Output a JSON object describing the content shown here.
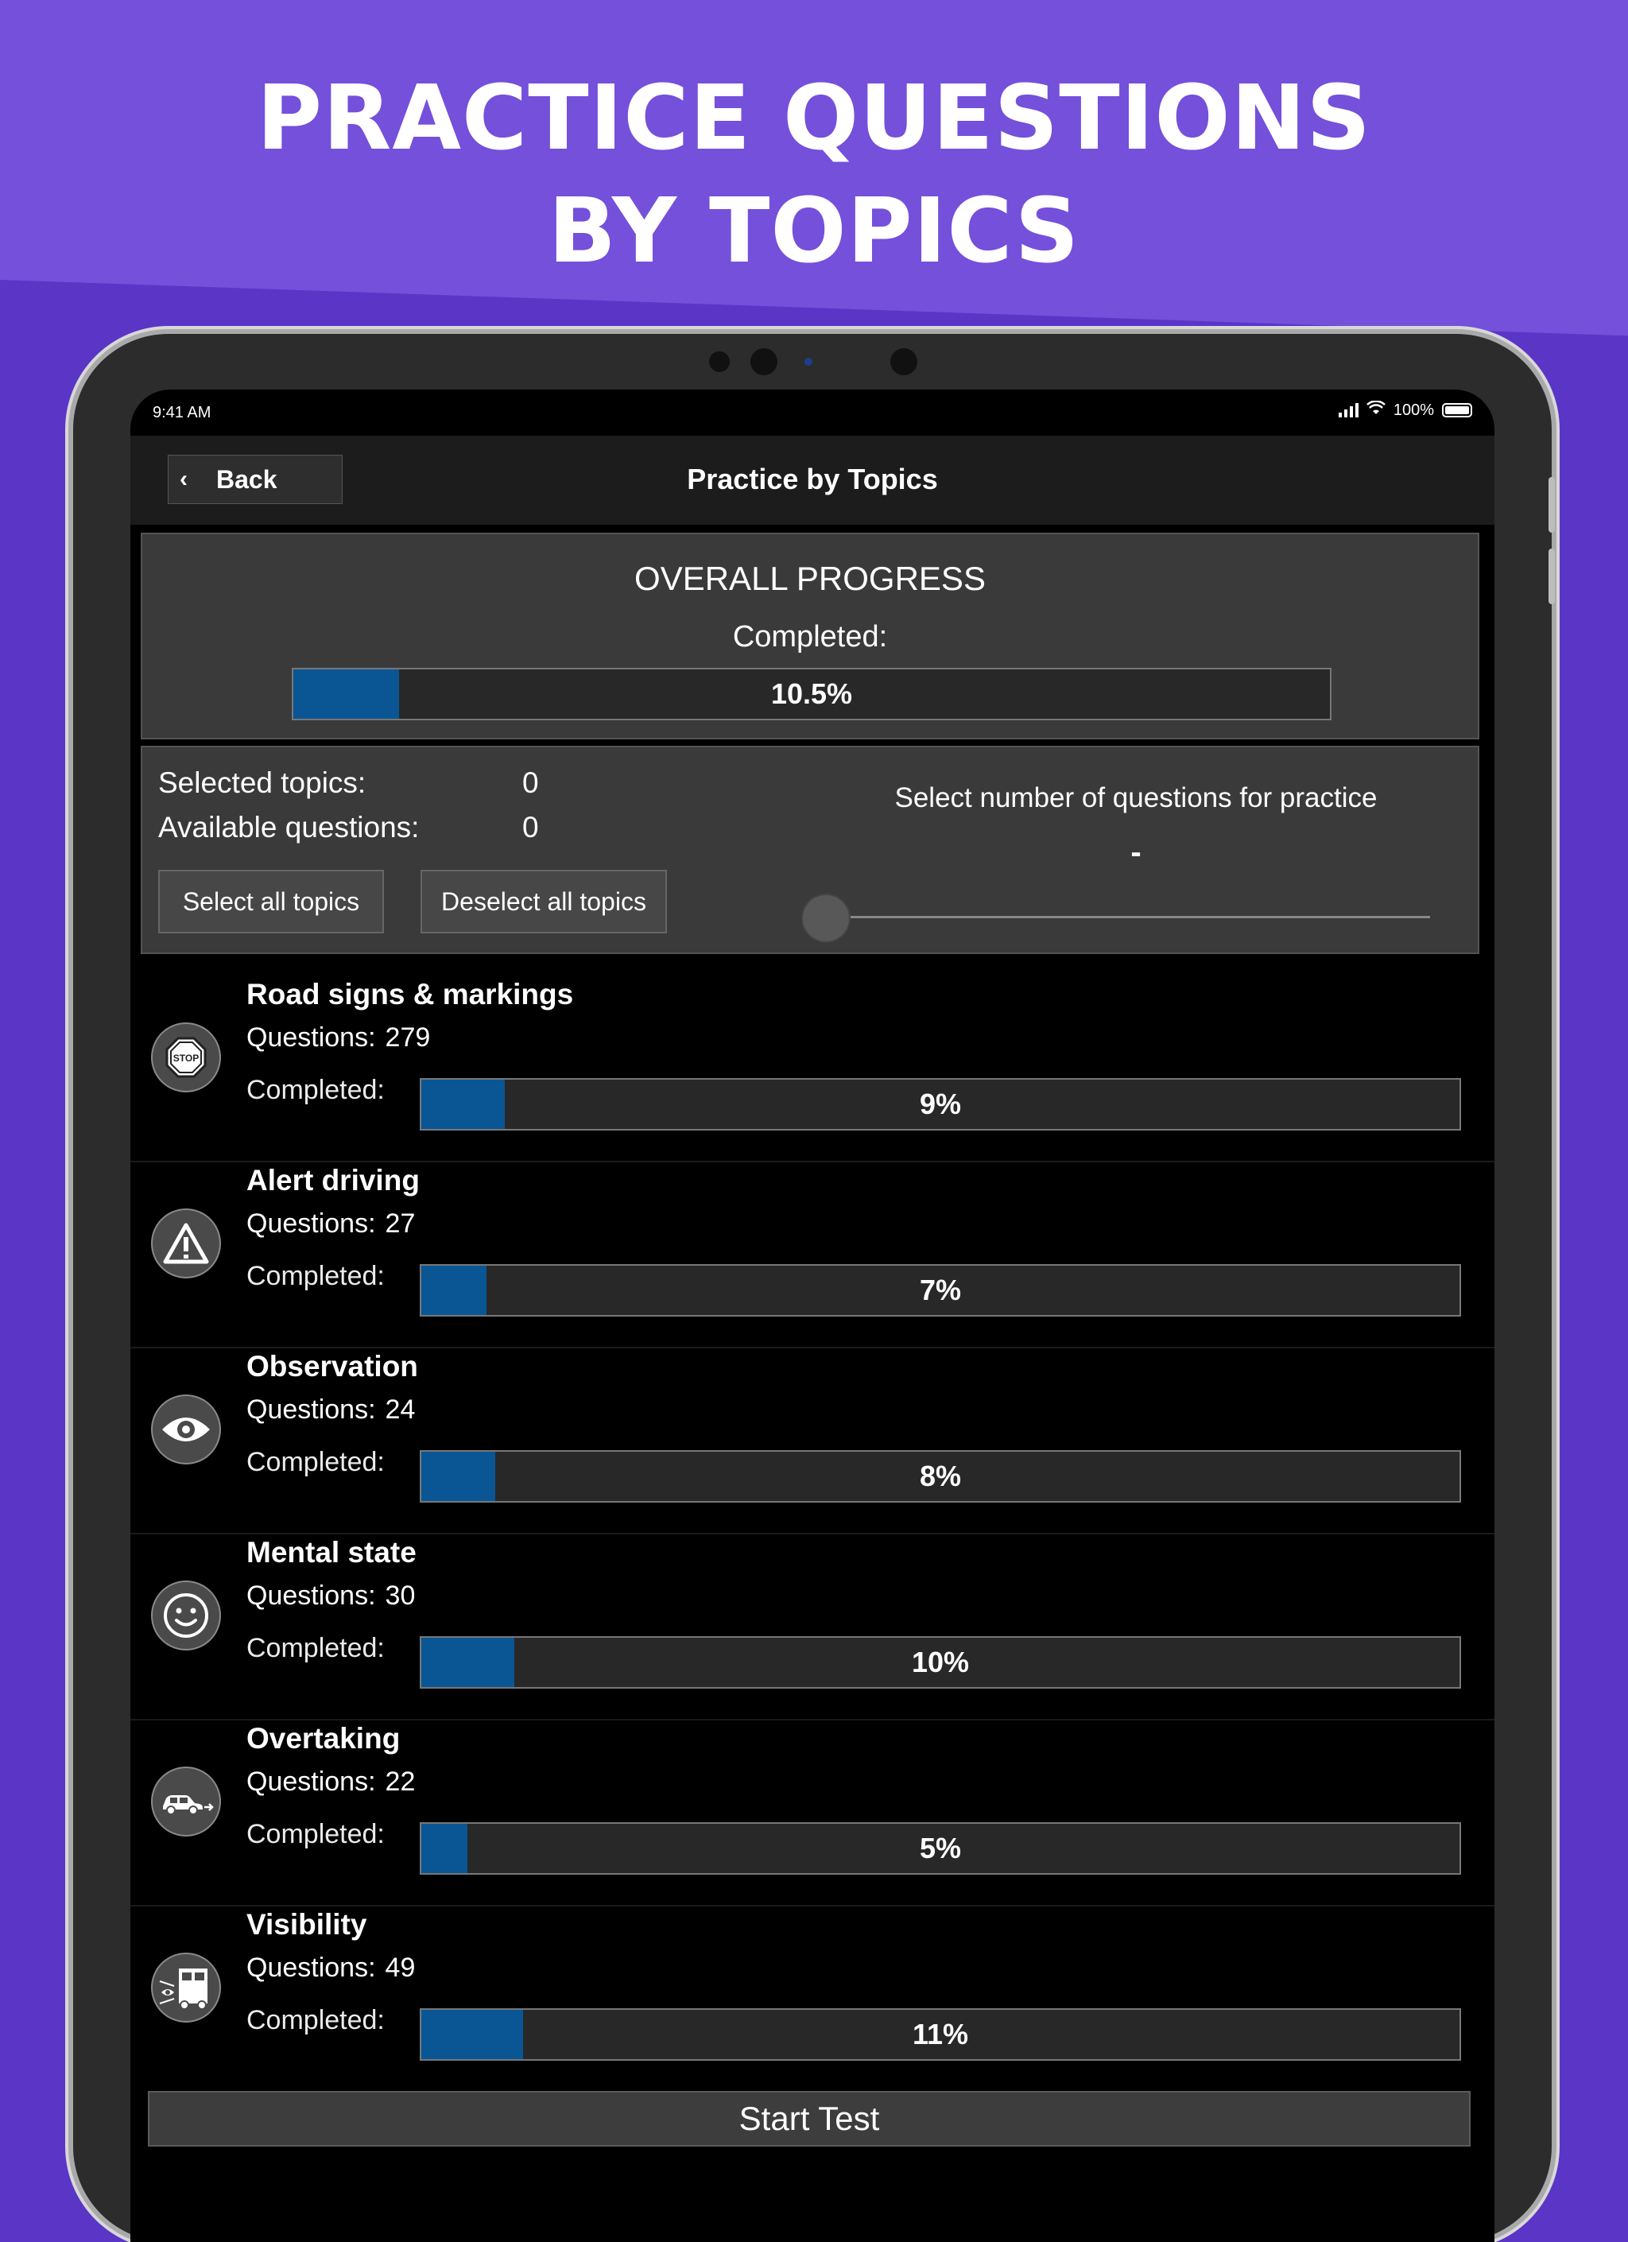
{
  "headline": {
    "line1": "PRACTICE QUESTIONS",
    "line2": "BY TOPICS"
  },
  "status_bar": {
    "time": "9:41 AM",
    "battery": "100%"
  },
  "navbar": {
    "back_label": "Back",
    "title": "Practice by Topics"
  },
  "overall": {
    "title": "OVERALL PROGRESS",
    "completed_label": "Completed:",
    "progress_percent": 10.5,
    "progress_label": "10.5%"
  },
  "selection": {
    "selected_topics_label": "Selected topics:",
    "selected_topics_value": "0",
    "available_questions_label": "Available questions:",
    "available_questions_value": "0",
    "select_all_label": "Select all topics",
    "deselect_all_label": "Deselect all topics",
    "slider_title": "Select number of questions for practice",
    "slider_value": "-",
    "slider_level": 0
  },
  "topics": [
    {
      "name": "Road signs & markings",
      "questions_label": "Questions:",
      "questions": "279",
      "completed_label": "Completed:",
      "percent": 9,
      "percent_label": "9%",
      "icon": "stop-sign-icon"
    },
    {
      "name": "Alert driving",
      "questions_label": "Questions:",
      "questions": "27",
      "completed_label": "Completed:",
      "percent": 7,
      "percent_label": "7%",
      "icon": "warning-icon"
    },
    {
      "name": "Observation",
      "questions_label": "Questions:",
      "questions": "24",
      "completed_label": "Completed:",
      "percent": 8,
      "percent_label": "8%",
      "icon": "eye-icon"
    },
    {
      "name": "Mental state",
      "questions_label": "Questions:",
      "questions": "30",
      "completed_label": "Completed:",
      "percent": 10,
      "percent_label": "10%",
      "icon": "smiley-icon"
    },
    {
      "name": "Overtaking",
      "questions_label": "Questions:",
      "questions": "22",
      "completed_label": "Completed:",
      "percent": 5,
      "percent_label": "5%",
      "icon": "car-overtaking-icon"
    },
    {
      "name": "Visibility",
      "questions_label": "Questions:",
      "questions": "49",
      "completed_label": "Completed:",
      "percent": 11,
      "percent_label": "11%",
      "icon": "truck-visibility-icon"
    }
  ],
  "start_button": {
    "label": "Start Test"
  },
  "colors": {
    "background": "#5a35c6",
    "header": "#7450db",
    "progress_fill": "#0a5694",
    "panel": "#3a3a3a"
  }
}
